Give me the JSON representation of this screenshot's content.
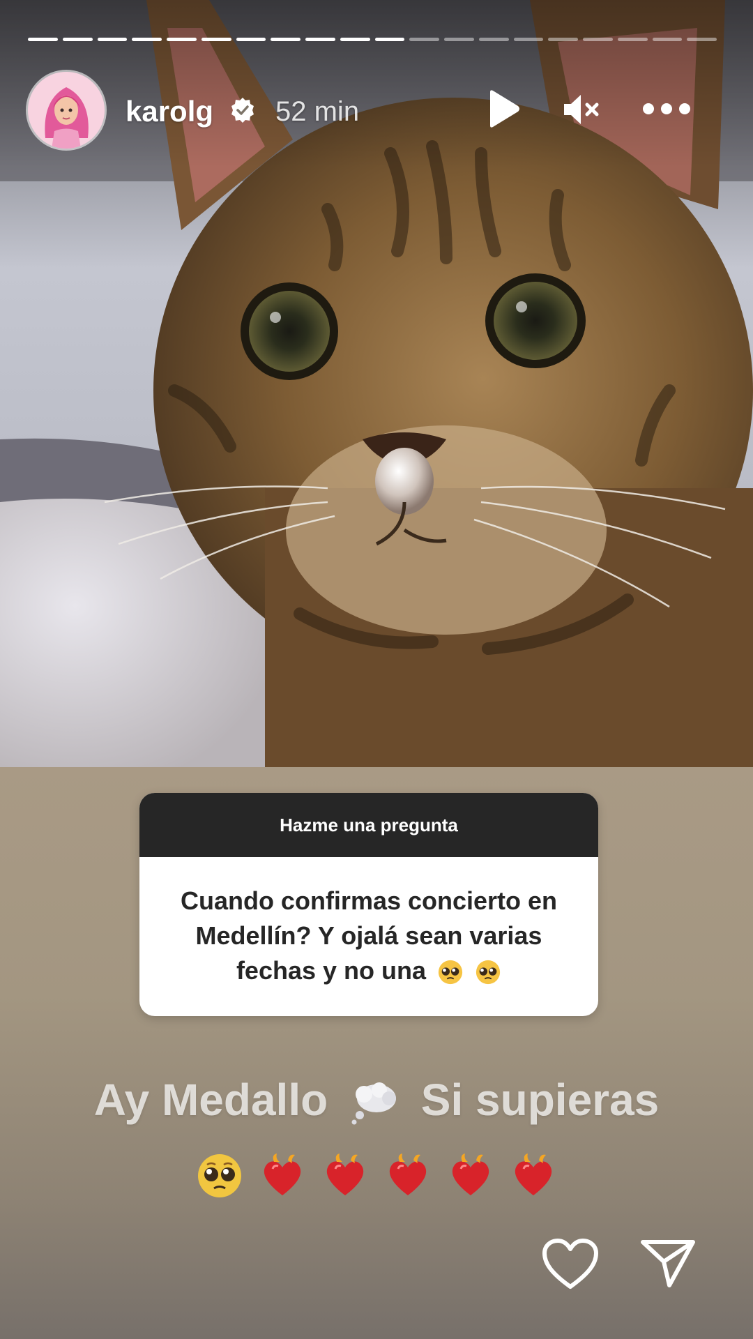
{
  "story": {
    "progress": {
      "segments": 20,
      "completed": 11
    },
    "header": {
      "username": "karolg",
      "verified": true,
      "time": "52 min"
    },
    "icons": {
      "play": "play-icon",
      "mute": "mute-icon",
      "more": "more-icon",
      "like": "heart-icon",
      "share": "send-icon"
    },
    "question_sticker": {
      "title": "Hazme una pregunta",
      "line1": "Cuando confirmas concierto en",
      "line2": "Medellín? Y ojalá sean varias",
      "line3": "fechas y no una"
    },
    "caption": {
      "part1": "Ay Medallo",
      "part2": "Si supieras"
    },
    "colors": {
      "sticker_header": "#262626",
      "heart_red": "#d8232a"
    }
  }
}
